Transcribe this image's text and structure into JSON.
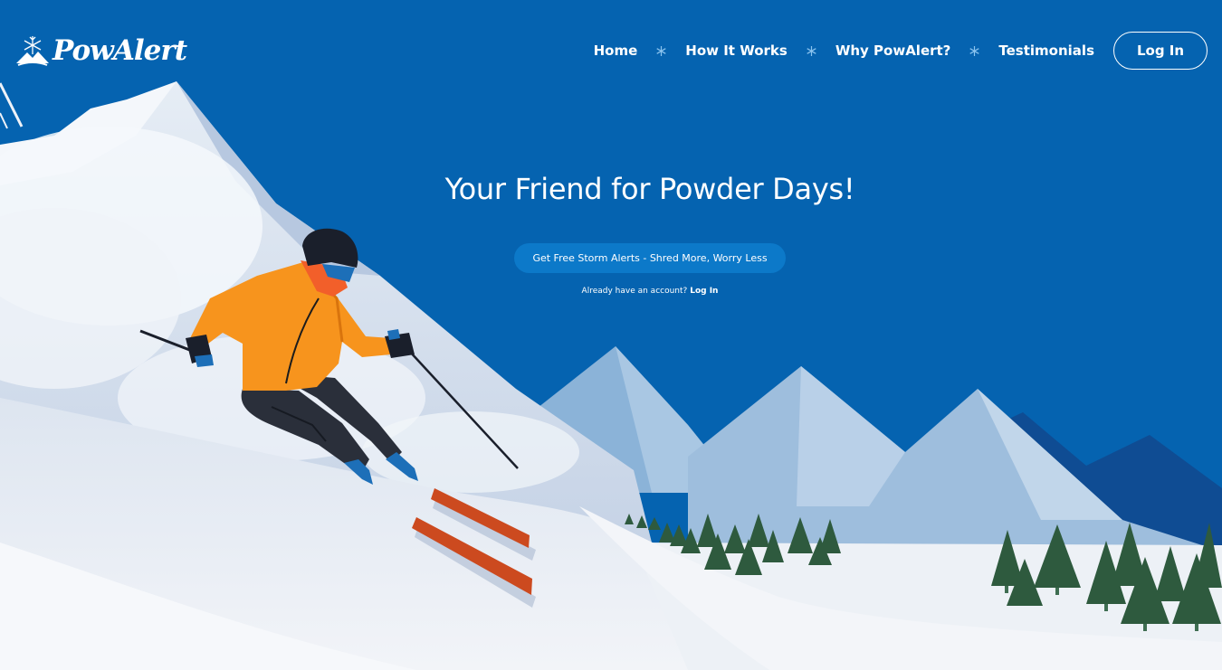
{
  "brand": {
    "name": "PowAlert"
  },
  "nav": {
    "links": [
      "Home",
      "How It Works",
      "Why PowAlert?",
      "Testimonials"
    ],
    "login_label": "Log In"
  },
  "hero": {
    "title": "Your Friend for Powder Days!",
    "cta_label": "Get Free Storm Alerts - Shred More, Worry Less",
    "account_prompt": "Already have an account?",
    "account_link": "Log In"
  },
  "icons": {
    "logo": "snowflake-mountain-icon",
    "separator": "snowflake-icon"
  },
  "colors": {
    "sky": "#0563b0",
    "cta": "#0c79c9",
    "jacket": "#f7941d",
    "skis": "#cc4a1f",
    "trees": "#2e5a3e",
    "snow": "#e6ecf4"
  }
}
